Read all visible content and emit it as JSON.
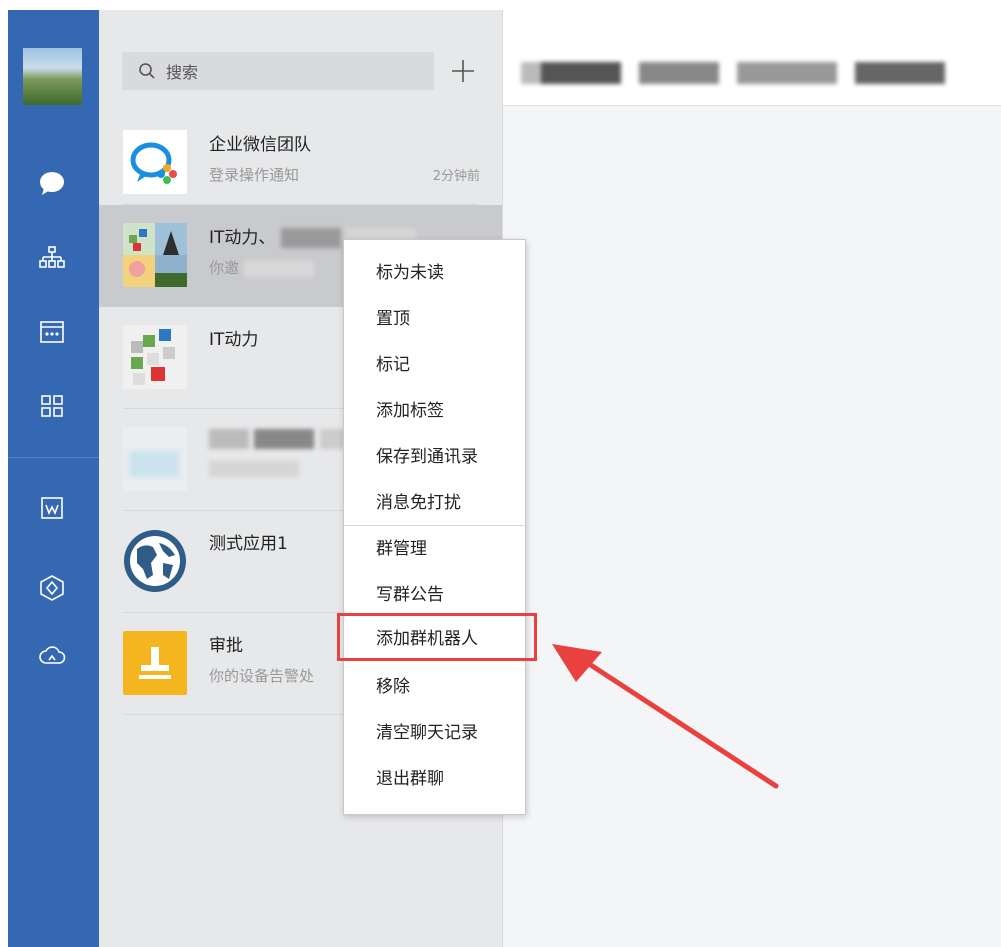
{
  "search": {
    "placeholder": "搜索"
  },
  "icons": {
    "chat": "chat-bubble-icon",
    "contacts": "org-tree-icon",
    "calendar": "calendar-icon",
    "apps": "grid-icon",
    "doc": "document-icon",
    "workbench": "hexagon-icon",
    "cloud": "cloud-icon"
  },
  "conversations": [
    {
      "name": "企业微信团队",
      "message": "登录操作通知",
      "time": "2分钟前"
    },
    {
      "name": "IT动力、",
      "message": "你邀"
    },
    {
      "name": "IT动力",
      "message": ""
    },
    {
      "name": "",
      "message": ""
    },
    {
      "name": "测式应用1",
      "message": ""
    },
    {
      "name": "审批",
      "message": "你的设备告警处"
    }
  ],
  "context_menu": {
    "items": [
      "标为未读",
      "置顶",
      "标记",
      "添加标签",
      "保存到通讯录",
      "消息免打扰",
      "群管理",
      "写群公告",
      "添加群机器人",
      "移除",
      "清空聊天记录",
      "退出群聊"
    ],
    "highlighted": "添加群机器人"
  },
  "colors": {
    "sidebar": "#3568b3",
    "list_bg": "#e7e8ea",
    "selected": "#c9cacd",
    "highlight": "#e9413f"
  }
}
